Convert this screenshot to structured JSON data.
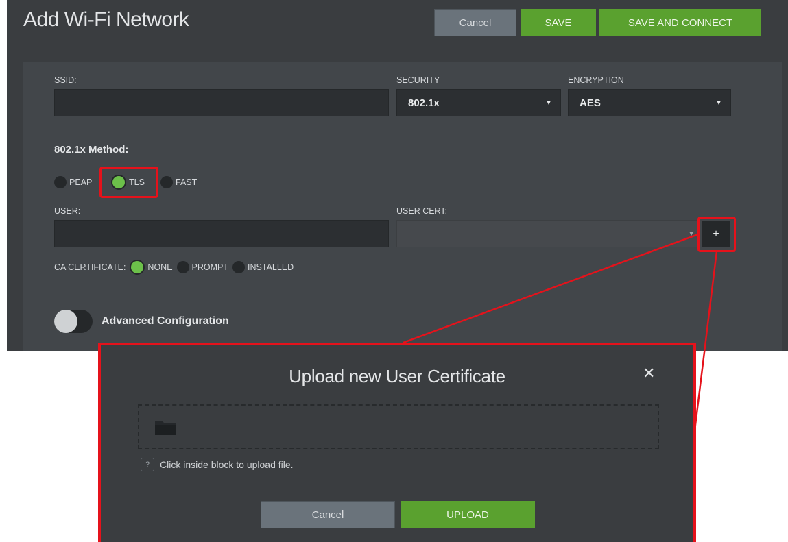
{
  "page": {
    "title": "Add Wi-Fi Network"
  },
  "header": {
    "cancel_label": "Cancel",
    "save_label": "SAVE",
    "save_connect_label": "SAVE AND CONNECT"
  },
  "form": {
    "ssid": {
      "label": "SSID:",
      "value": ""
    },
    "security": {
      "label": "SECURITY",
      "value": "802.1x"
    },
    "encryption": {
      "label": "ENCRYPTION",
      "value": "AES"
    },
    "method": {
      "label": "802.1x Method:",
      "options": [
        "PEAP",
        "TLS",
        "FAST"
      ],
      "selected": "TLS"
    },
    "user": {
      "label": "USER:",
      "value": ""
    },
    "user_cert": {
      "label": "USER CERT:",
      "value": "",
      "add_label": "+"
    },
    "ca_certificate": {
      "label": "CA CERTIFICATE:",
      "options": [
        "NONE",
        "PROMPT",
        "INSTALLED"
      ],
      "selected": "NONE"
    },
    "advanced": {
      "label": "Advanced Configuration",
      "enabled": false
    }
  },
  "modal": {
    "title": "Upload new User Certificate",
    "close_label": "✕",
    "help_badge": "?",
    "help_text": "Click inside block to upload file.",
    "cancel_label": "Cancel",
    "upload_label": "UPLOAD"
  },
  "colors": {
    "background": "#3a3d40",
    "panel": "#42464a",
    "field": "#2c2f32",
    "accent_green": "#5aa12f",
    "radio_on": "#6cc04a",
    "highlight_red": "#e5121b"
  }
}
